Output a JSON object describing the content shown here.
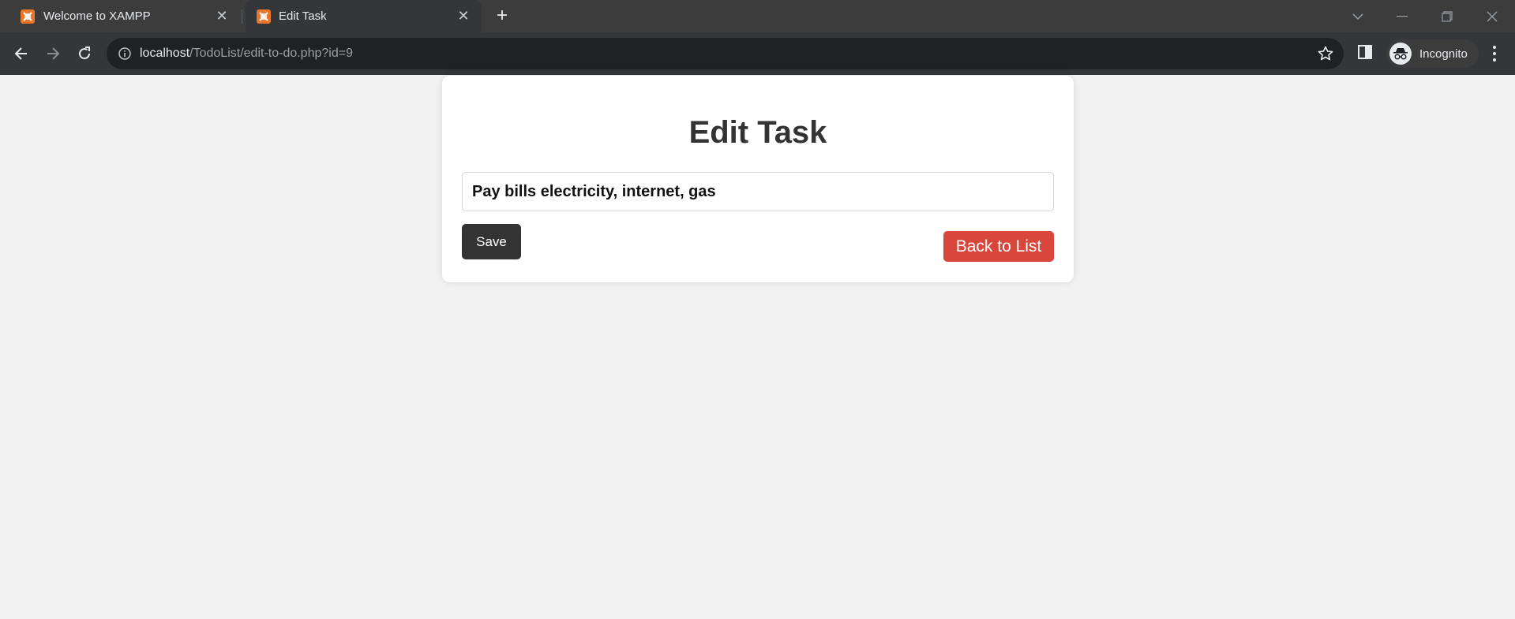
{
  "browser": {
    "tabs": [
      {
        "title": "Welcome to XAMPP",
        "active": false
      },
      {
        "title": "Edit Task",
        "active": true
      }
    ],
    "url_host": "localhost",
    "url_path": "/TodoList/edit-to-do.php?id=9",
    "profile_label": "Incognito"
  },
  "page": {
    "heading": "Edit Task",
    "task_value": "Pay bills electricity, internet, gas",
    "save_label": "Save",
    "back_label": "Back to List"
  },
  "colors": {
    "accent_dark": "#333333",
    "back_button": "#d9463b",
    "page_background": "#f2f2f2"
  }
}
